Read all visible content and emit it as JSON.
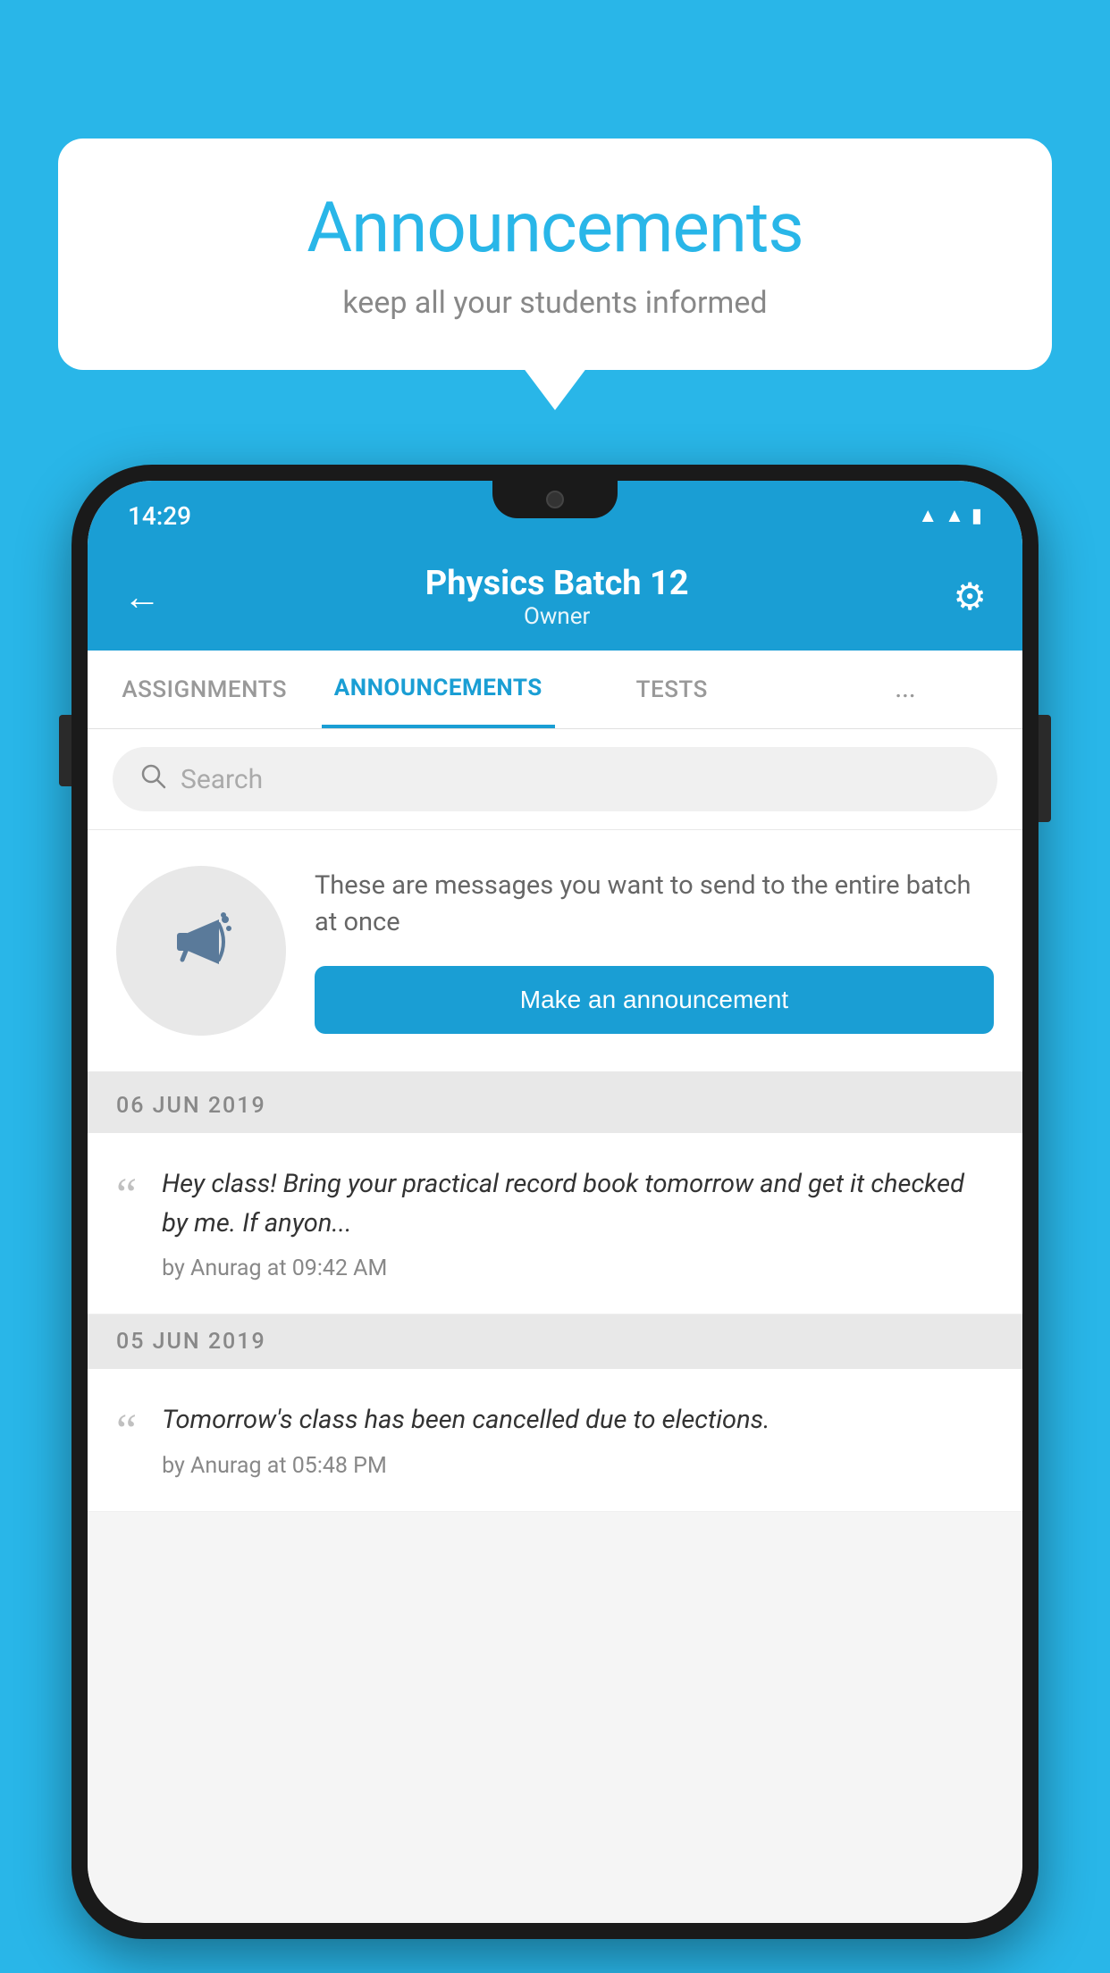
{
  "background_color": "#29b6e8",
  "speech_bubble": {
    "title": "Announcements",
    "subtitle": "keep all your students informed"
  },
  "status_bar": {
    "time": "14:29",
    "icons": [
      "wifi",
      "signal",
      "battery"
    ]
  },
  "header": {
    "title": "Physics Batch 12",
    "subtitle": "Owner",
    "back_label": "←",
    "settings_label": "⚙"
  },
  "tabs": [
    {
      "label": "ASSIGNMENTS",
      "active": false
    },
    {
      "label": "ANNOUNCEMENTS",
      "active": true
    },
    {
      "label": "TESTS",
      "active": false
    },
    {
      "label": "...",
      "active": false
    }
  ],
  "search": {
    "placeholder": "Search"
  },
  "announcement_prompt": {
    "description_text": "These are messages you want to send to the entire batch at once",
    "button_label": "Make an announcement"
  },
  "date_groups": [
    {
      "date": "06  JUN  2019",
      "items": [
        {
          "text": "Hey class! Bring your practical record book tomorrow and get it checked by me. If anyon...",
          "meta": "by Anurag at 09:42 AM"
        }
      ]
    },
    {
      "date": "05  JUN  2019",
      "items": [
        {
          "text": "Tomorrow's class has been cancelled due to elections.",
          "meta": "by Anurag at 05:48 PM"
        }
      ]
    }
  ]
}
